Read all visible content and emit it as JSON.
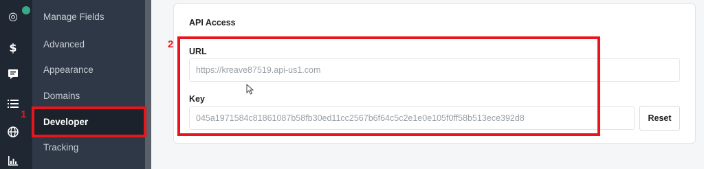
{
  "icons": [
    "target-icon",
    "dollar-icon",
    "chat-icon",
    "list-icon",
    "globe-icon",
    "bar-chart-icon"
  ],
  "sidebar": {
    "items": [
      {
        "label": "Manage Fields"
      },
      {
        "label": "Advanced"
      },
      {
        "label": "Appearance"
      },
      {
        "label": "Domains"
      },
      {
        "label": "Developer",
        "active": true
      },
      {
        "label": "Tracking"
      }
    ]
  },
  "api": {
    "title": "API Access",
    "url_label": "URL",
    "url_value": "https://kreave87519.api-us1.com",
    "key_label": "Key",
    "key_value": "045a1971584c81861087b58fb30ed11cc2567b6f64c5c2e1e0e105f0ff58b513ece392d8",
    "reset_label": "Reset"
  },
  "annotations": {
    "marker1": "1",
    "marker2": "2"
  },
  "colors": {
    "annotation_red": "#e8161c",
    "sidebar_bg": "#2e3846",
    "active_bg": "#1b222b"
  }
}
